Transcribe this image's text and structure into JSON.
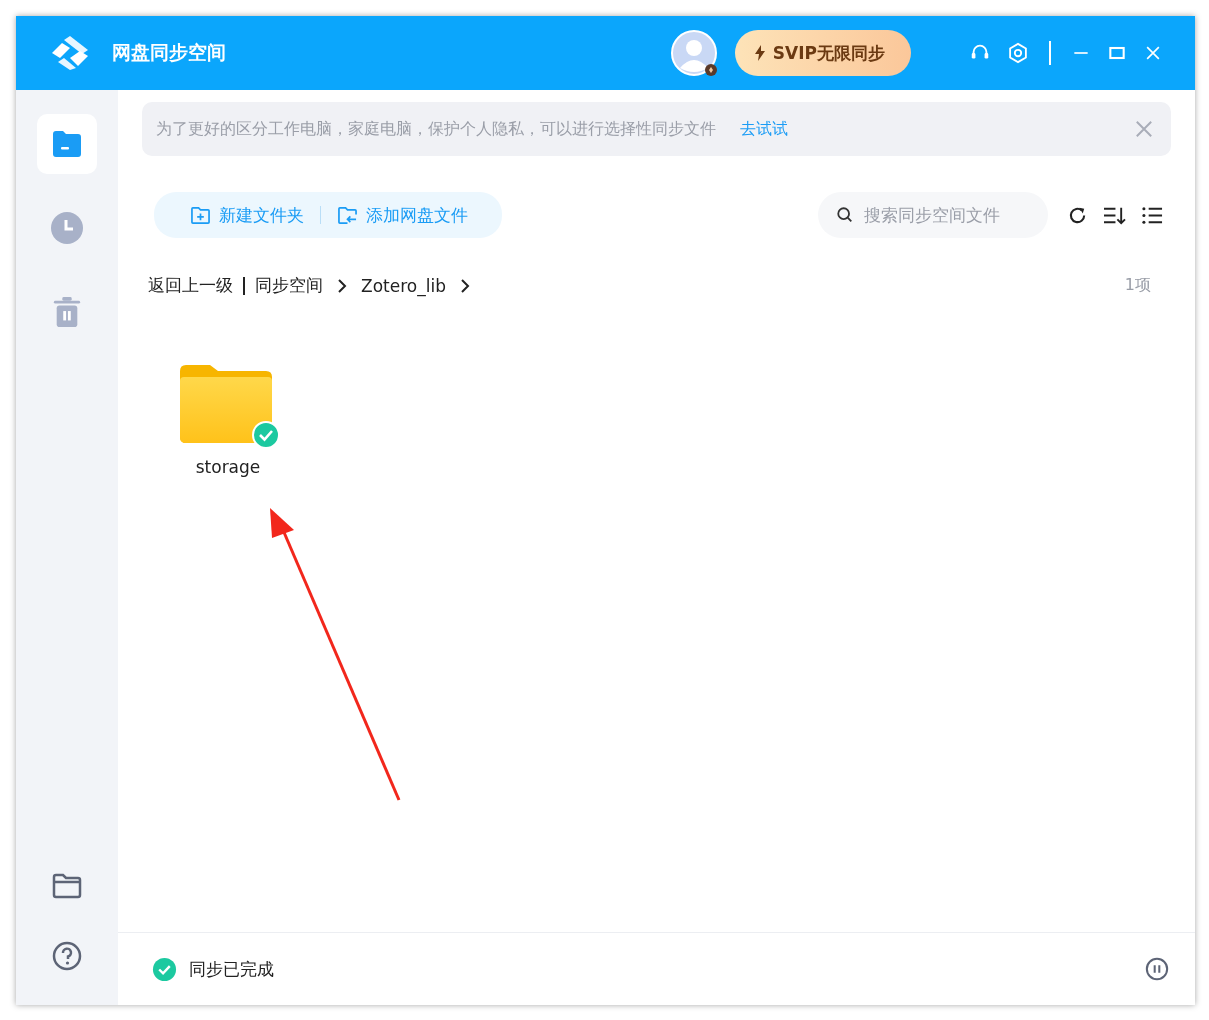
{
  "window": {
    "title": "网盘同步空间",
    "vip_button": "SVIP无限同步"
  },
  "sidebar": {
    "items": [
      {
        "kind": "folder",
        "selected": true
      },
      {
        "kind": "clock",
        "selected": false
      },
      {
        "kind": "trash",
        "selected": false
      }
    ],
    "bottom_items": [
      {
        "kind": "folder-outline"
      },
      {
        "kind": "help"
      }
    ]
  },
  "banner": {
    "text": "为了更好的区分工作电脑，家庭电脑，保护个人隐私，可以进行选择性同步文件",
    "link": "去试试"
  },
  "toolbar": {
    "buttons": [
      "新建文件夹",
      "添加网盘文件"
    ],
    "search": {
      "placeholder": "搜索同步空间文件"
    }
  },
  "breadcrumb": {
    "back": "返回上一级",
    "path": [
      "同步空间",
      "Zotero_lib"
    ],
    "count": "1项"
  },
  "files": [
    {
      "name": "storage",
      "synced": true
    }
  ],
  "status_bar": {
    "text": "同步已完成"
  }
}
